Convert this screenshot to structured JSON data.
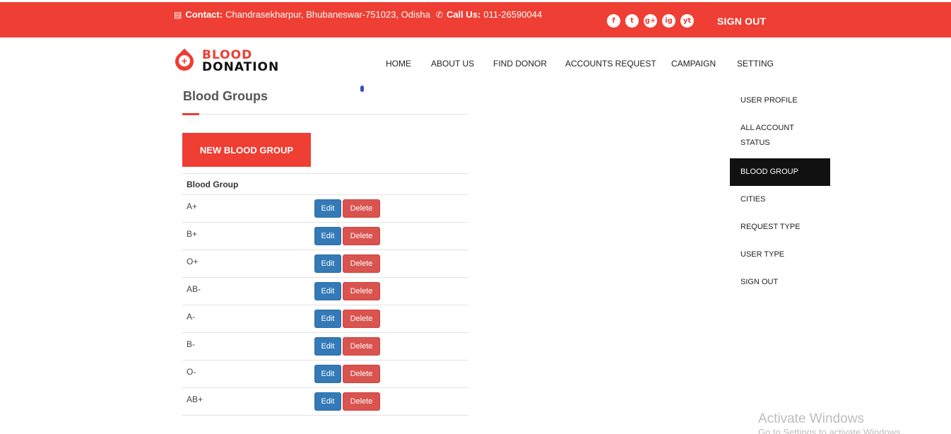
{
  "topbar": {
    "contact_label": "Contact:",
    "contact_value": "Chandrasekharpur, Bhubaneswar-751023, Odisha",
    "call_label": "Call Us:",
    "call_value": "011-26590044",
    "social": [
      "f",
      "t",
      "g+",
      "ig",
      "yt"
    ],
    "signout_label": "SIGN OUT",
    "bg_color": "#ef3e33"
  },
  "logo": {
    "line1": "BLOOD",
    "line2": "DONATION"
  },
  "nav": [
    "HOME",
    "ABOUT US",
    "FIND DONOR",
    "ACCOUNTS REQUEST",
    "CAMPAIGN",
    "SETTING"
  ],
  "main": {
    "title": "Blood Groups",
    "new_button": "NEW BLOOD GROUP",
    "table_header": "Blood Group",
    "edit_label": "Edit",
    "delete_label": "Delete",
    "groups": [
      "A+",
      "B+",
      "O+",
      "AB-",
      "A-",
      "B-",
      "O-",
      "AB+"
    ]
  },
  "side_menu": {
    "items": [
      "USER PROFILE",
      "ALL ACCOUNT STATUS",
      "BLOOD GROUP",
      "CITIES",
      "REQUEST TYPE",
      "USER TYPE",
      "SIGN OUT"
    ],
    "active": "BLOOD GROUP"
  },
  "watermark": {
    "line1": "Activate Windows",
    "line2": "Go to Settings to activate Windows."
  }
}
